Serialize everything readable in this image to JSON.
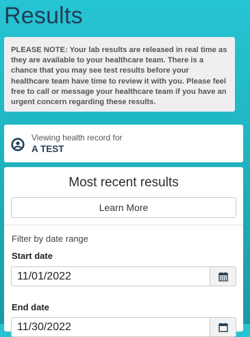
{
  "page": {
    "title": "Results"
  },
  "notice": {
    "text": "PLEASE NOTE: Your lab results are released in real time as they are available to your healthcare team. There is a chance that you may see test results before your healthcare team have time to review it with you. Please feel free to call or message your healthcare team if you have an urgent concern regarding these results."
  },
  "record": {
    "label": "Viewing health record for",
    "name": "A TEST",
    "icon": "user-circle-icon"
  },
  "results": {
    "title": "Most recent results",
    "learn_more_label": "Learn More",
    "filter_label": "Filter by date range",
    "start_date_label": "Start date",
    "start_date_value": "11/01/2022",
    "end_date_label": "End date",
    "end_date_value": "11/30/2022",
    "calendar_icon": "calendar-icon"
  },
  "colors": {
    "background_top": "#27c4d3",
    "title": "#1f3d55",
    "notice_bg": "#efeef1",
    "card_bg": "#ffffff"
  }
}
